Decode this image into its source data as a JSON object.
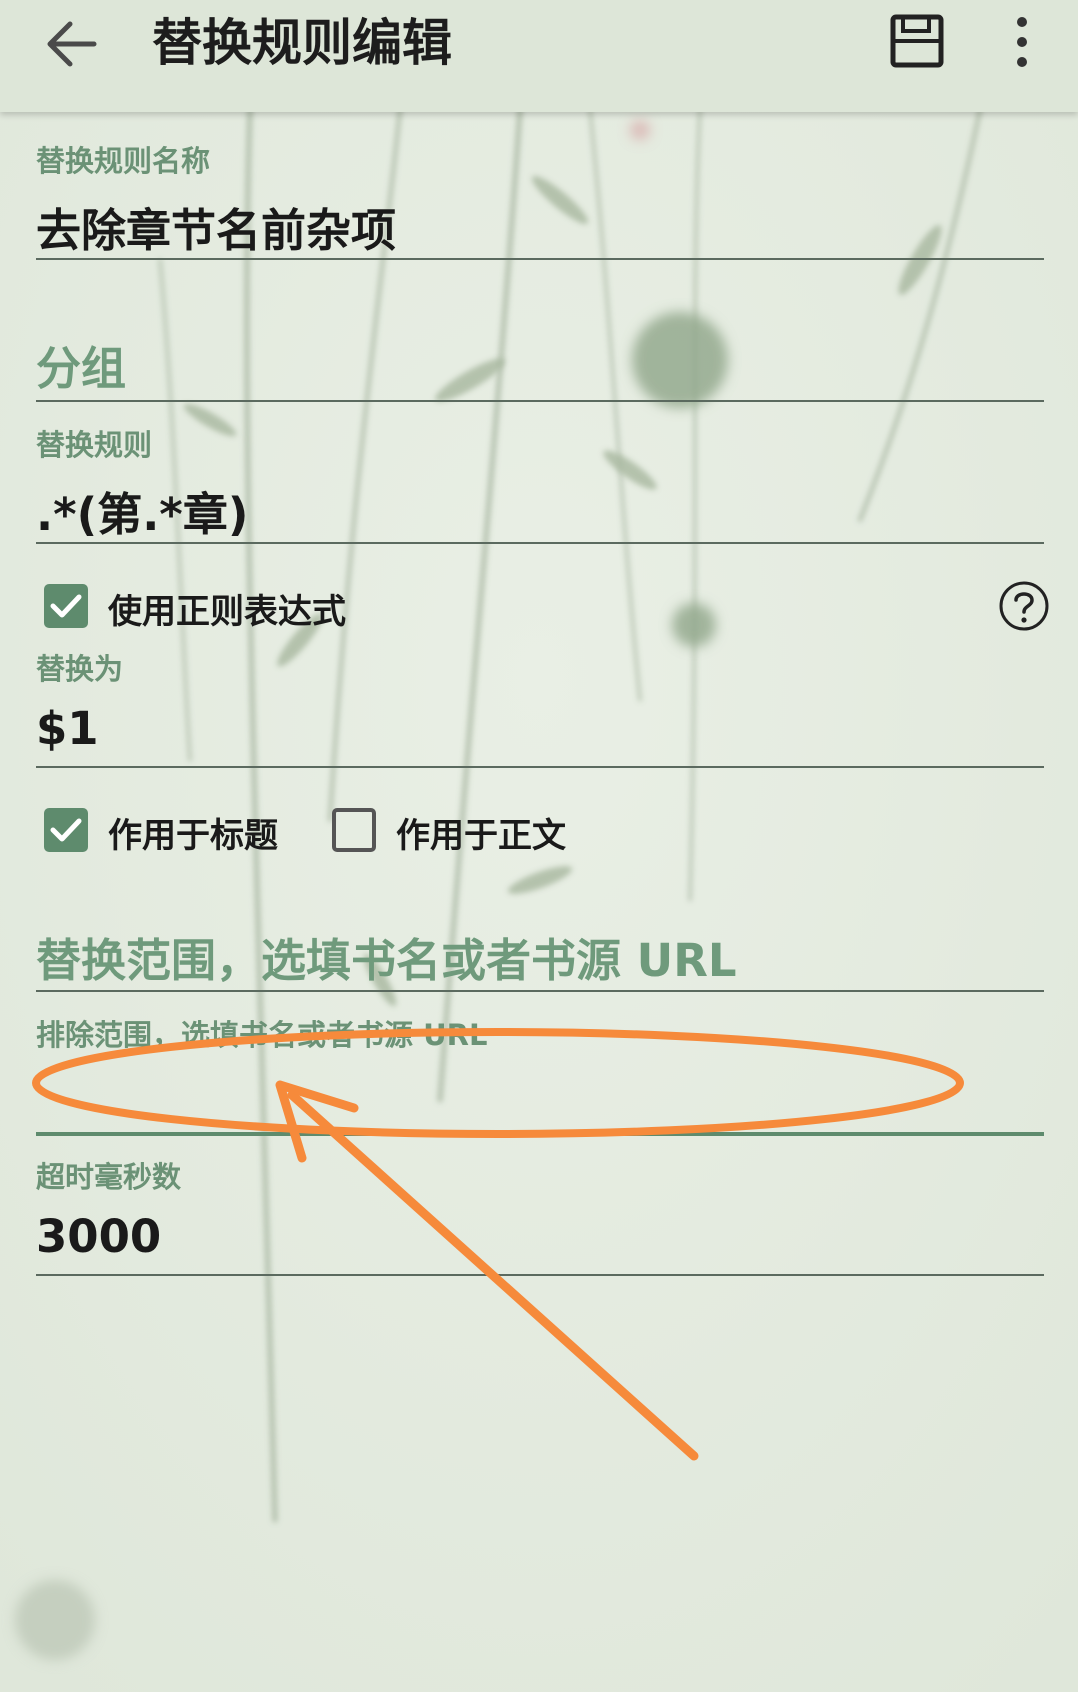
{
  "toolbar": {
    "title": "替换规则编辑",
    "back_icon": "arrow-left-icon",
    "save_icon": "save-icon",
    "more_icon": "more-vertical-icon"
  },
  "form": {
    "name": {
      "label": "替换规则名称",
      "value": "去除章节名前杂项"
    },
    "group": {
      "placeholder": "分组",
      "value": ""
    },
    "pattern": {
      "label": "替换规则",
      "value": ".*(第.*章)"
    },
    "use_regex": {
      "label": "使用正则表达式",
      "checked": true,
      "help_icon": "help-circle-icon"
    },
    "replacement": {
      "label": "替换为",
      "value": "$1"
    },
    "scope_title": {
      "label": "作用于标题",
      "checked": true
    },
    "scope_content": {
      "label": "作用于正文",
      "checked": false
    },
    "scope": {
      "placeholder": "替换范围，选填书名或者书源 URL",
      "value": ""
    },
    "exclude_scope": {
      "label": "排除范围，选填书名或者书源 URL",
      "value": ""
    },
    "timeout": {
      "label": "超时毫秒数",
      "value": "3000"
    }
  },
  "colors": {
    "accent": "#5e8b6d",
    "toolbar_bg": "#dde6d8",
    "page_bg": "#e6ece2",
    "annotation": "#f68a3b"
  }
}
